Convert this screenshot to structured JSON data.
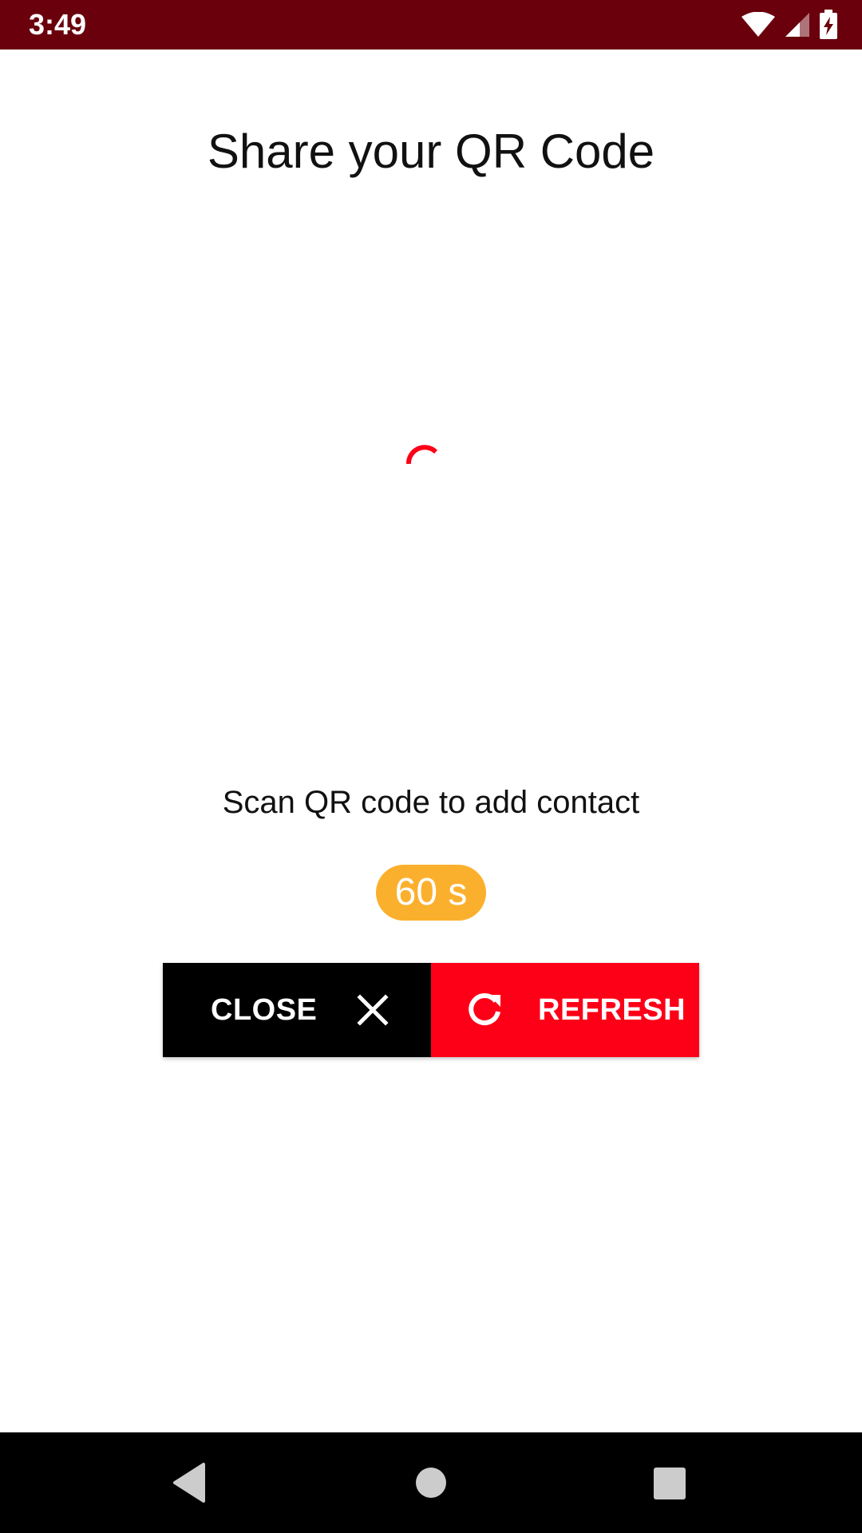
{
  "status_bar": {
    "time": "3:49",
    "icons": [
      "wifi-icon",
      "cell-signal-icon",
      "battery-charging-icon"
    ],
    "background_color": "#6a000c"
  },
  "page": {
    "title": "Share your QR Code",
    "instruction": "Scan QR code to add contact",
    "timer": "60 s",
    "loading": true
  },
  "actions": {
    "close_label": "CLOSE",
    "close_icon": "close-icon",
    "refresh_label": "REFRESH",
    "refresh_icon": "refresh-icon"
  },
  "navigation_bar": {
    "buttons": [
      "back-icon",
      "home-icon",
      "recents-icon"
    ]
  },
  "colors": {
    "accent_red": "#fd0017",
    "timer_badge": "#fbb02d",
    "close_button": "#000000",
    "status_bar": "#6a000c"
  }
}
